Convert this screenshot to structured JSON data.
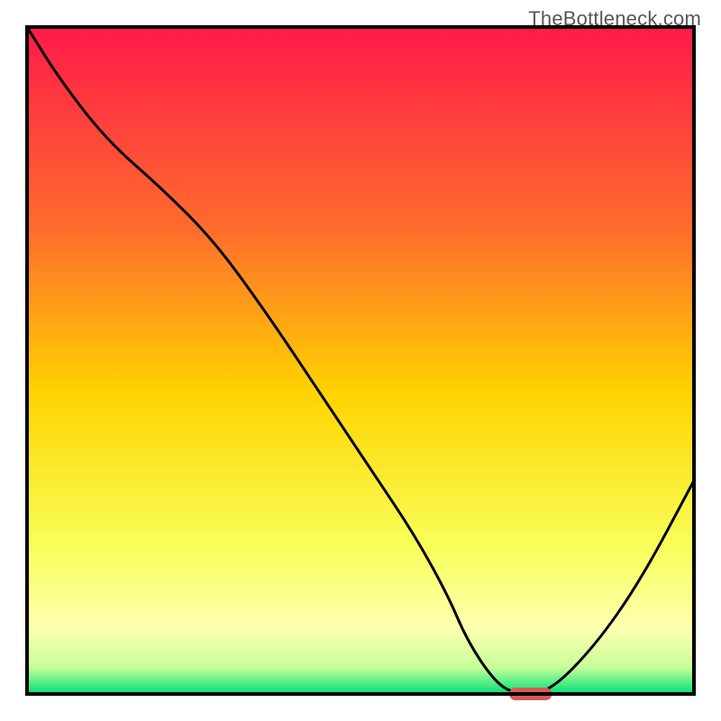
{
  "attribution": "TheBottleneck.com",
  "colors": {
    "gradient_top": "#ff1a4a",
    "gradient_mid_upper": "#ff6b2d",
    "gradient_mid": "#ffd400",
    "gradient_lower": "#f8ff5a",
    "gradient_bottom_yellow": "#ffffb0",
    "gradient_green": "#00e077",
    "curve": "#000000",
    "marker": "#d65a5a",
    "axis": "#000000"
  },
  "chart_data": {
    "type": "line",
    "title": "",
    "xlabel": "",
    "ylabel": "",
    "x": [
      0,
      5,
      12,
      20,
      28,
      36,
      44,
      52,
      58,
      63,
      66,
      70,
      73,
      78,
      85,
      92,
      100
    ],
    "y": [
      100,
      92,
      83,
      76,
      68,
      57,
      45,
      33,
      24,
      15,
      8,
      2,
      0,
      0,
      7,
      17,
      32
    ],
    "xlim": [
      0,
      100
    ],
    "ylim": [
      0,
      100
    ],
    "marker": {
      "x_center": 75.5,
      "x_halfwidth": 3.2,
      "y": 0
    }
  }
}
